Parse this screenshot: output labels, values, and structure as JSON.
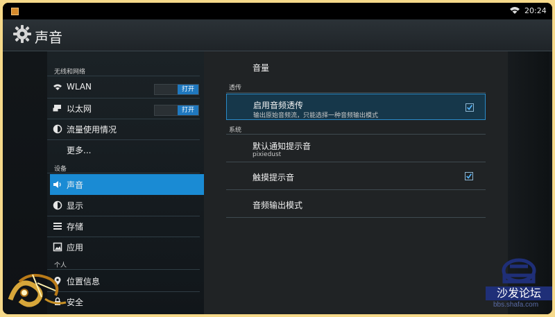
{
  "statusbar": {
    "time": "20:24"
  },
  "app": {
    "title": "声音"
  },
  "sidebar": {
    "sections": [
      {
        "label": "无线和网络"
      },
      {
        "label": "设备"
      },
      {
        "label": "个人"
      }
    ],
    "items": [
      {
        "label": "WLAN",
        "toggle": "打开"
      },
      {
        "label": "以太网",
        "toggle": "打开"
      },
      {
        "label": "流量使用情况"
      },
      {
        "label": "更多..."
      },
      {
        "label": "声音"
      },
      {
        "label": "显示"
      },
      {
        "label": "存储"
      },
      {
        "label": "应用"
      },
      {
        "label": "位置信息"
      },
      {
        "label": "安全"
      }
    ]
  },
  "prefs": {
    "title": "音量",
    "sections": [
      {
        "label": "透传"
      },
      {
        "label": "系统"
      }
    ],
    "rows": [
      {
        "title": "启用音频透传",
        "subtitle": "输出原始音频流，只能选择一种音频输出模式"
      },
      {
        "title": "默认通知提示音",
        "subtitle": "pixiedust"
      },
      {
        "title": "触摸提示音"
      },
      {
        "title": "音频输出模式"
      }
    ]
  },
  "watermark": {
    "brand": "沙发论坛",
    "url": "bbs.shafa.com"
  },
  "colors": {
    "accent": "#1a8bd4",
    "frame": "#f6d98a",
    "brand": "#1f2f78"
  }
}
